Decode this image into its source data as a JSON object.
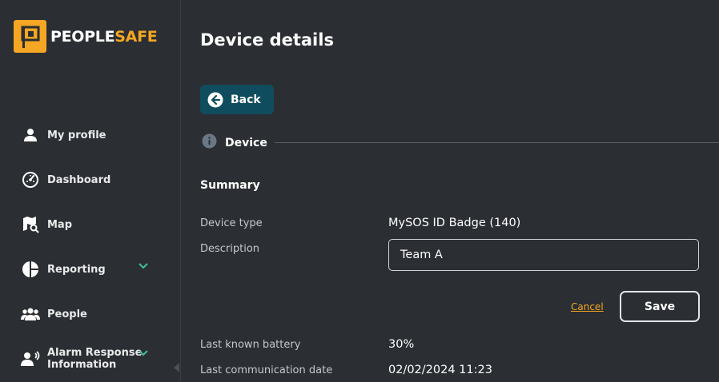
{
  "brand": {
    "name_part1": "PEOPLE",
    "name_part2": "SAFE",
    "accent_color": "#f5a623"
  },
  "sidebar": {
    "items": [
      {
        "label": "My profile",
        "icon": "user-icon"
      },
      {
        "label": "Dashboard",
        "icon": "gauge-icon"
      },
      {
        "label": "Map",
        "icon": "map-search-icon"
      },
      {
        "label": "Reporting",
        "icon": "pie-chart-icon",
        "expandable": true
      },
      {
        "label": "People",
        "icon": "people-icon"
      },
      {
        "label": "Alarm Response",
        "label_line2": "Information",
        "icon": "alarm-person-icon",
        "expandable": true
      }
    ]
  },
  "page": {
    "title": "Device details",
    "back_label": "Back",
    "section_label": "Device",
    "summary_label": "Summary",
    "fields": {
      "device_type_label": "Device type",
      "device_type_value": "MySOS ID Badge (140)",
      "description_label": "Description",
      "description_value": "Team A",
      "battery_label": "Last known battery",
      "battery_value": "30%",
      "last_comm_label": "Last communication date",
      "last_comm_value": "02/02/2024 11:23"
    },
    "cancel_label": "Cancel",
    "save_label": "Save"
  }
}
